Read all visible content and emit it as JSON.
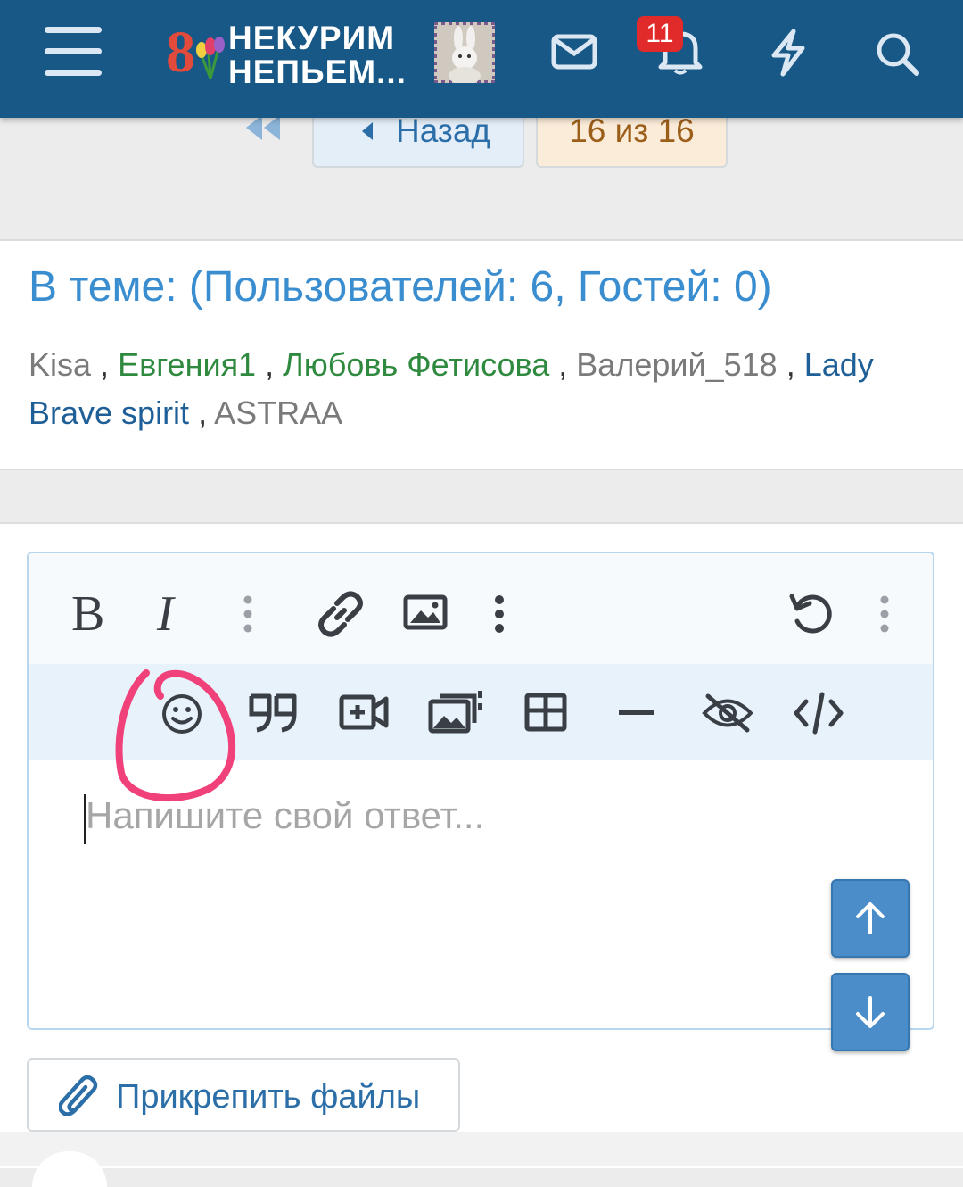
{
  "header": {
    "logo_line1": "НЕКУРИМ",
    "logo_line2": "НЕПЬЕМ...",
    "logo_mark": "8",
    "notification_count": "11",
    "icons": [
      "menu-icon",
      "inbox-icon",
      "bell-icon",
      "lightning-icon",
      "search-icon"
    ],
    "background_color": "#185886"
  },
  "pagination": {
    "back_label": "Назад",
    "page_label": "16 из 16"
  },
  "online": {
    "title": "В теме: (Пользователей: 6, Гостей: 0)",
    "users": [
      {
        "name": "Kisa",
        "color": "#7a7a7a"
      },
      {
        "name": "Евгения1",
        "color": "#2f8a3f"
      },
      {
        "name": "Любовь Фетисова",
        "color": "#2f8a3f"
      },
      {
        "name": "Валерий_518",
        "color": "#7a7a7a"
      },
      {
        "name": "Lady Brave spirit",
        "color": "#1f5f97"
      },
      {
        "name": "ASTRAA",
        "color": "#7a7a7a"
      }
    ],
    "separator": ","
  },
  "editor": {
    "toolbar_row1": [
      "bold",
      "italic",
      "more-text",
      "link",
      "image",
      "more-insert",
      "undo",
      "more-options"
    ],
    "toolbar_row2": [
      "smiley",
      "quote",
      "media",
      "gallery",
      "table",
      "horizontal-rule",
      "spoiler",
      "code"
    ],
    "bold_label": "B",
    "italic_label": "I",
    "placeholder": "Напишите свой ответ..."
  },
  "attach": {
    "label": "Прикрепить файлы"
  },
  "annotation": {
    "color": "#f0417a"
  }
}
